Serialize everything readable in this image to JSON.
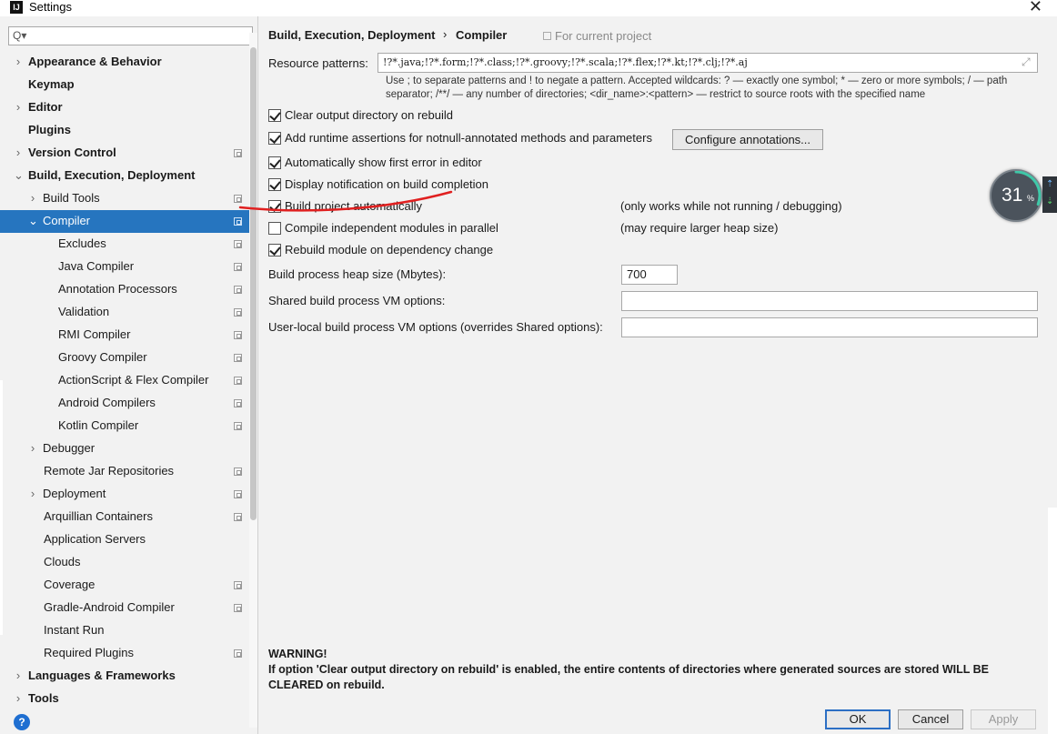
{
  "window": {
    "title": "Settings",
    "app_icon": "IJ",
    "close_glyph": "✕"
  },
  "sidebar": {
    "search_placeholder": "",
    "search_glyph": "Q▾",
    "items": [
      {
        "label": "Appearance & Behavior",
        "arrow": "›",
        "bold": true
      },
      {
        "label": "Keymap",
        "arrow": "",
        "bold": true
      },
      {
        "label": "Editor",
        "arrow": "›",
        "bold": true
      },
      {
        "label": "Plugins",
        "arrow": "",
        "bold": true
      },
      {
        "label": "Version Control",
        "arrow": "›",
        "bold": true
      },
      {
        "label": "Build, Execution, Deployment",
        "arrow": "⌄",
        "bold": true
      },
      {
        "label": "Build Tools",
        "arrow": "›",
        "bold": false
      },
      {
        "label": "Compiler",
        "arrow": "⌄",
        "bold": false,
        "selected": true
      },
      {
        "label": "Excludes",
        "arrow": "",
        "bold": false
      },
      {
        "label": "Java Compiler",
        "arrow": "",
        "bold": false
      },
      {
        "label": "Annotation Processors",
        "arrow": "",
        "bold": false
      },
      {
        "label": "Validation",
        "arrow": "",
        "bold": false
      },
      {
        "label": "RMI Compiler",
        "arrow": "",
        "bold": false
      },
      {
        "label": "Groovy Compiler",
        "arrow": "",
        "bold": false
      },
      {
        "label": "ActionScript & Flex Compiler",
        "arrow": "",
        "bold": false
      },
      {
        "label": "Android Compilers",
        "arrow": "",
        "bold": false
      },
      {
        "label": "Kotlin Compiler",
        "arrow": "",
        "bold": false
      },
      {
        "label": "Debugger",
        "arrow": "›",
        "bold": false
      },
      {
        "label": "Remote Jar Repositories",
        "arrow": "",
        "bold": false
      },
      {
        "label": "Deployment",
        "arrow": "›",
        "bold": false
      },
      {
        "label": "Arquillian Containers",
        "arrow": "",
        "bold": false
      },
      {
        "label": "Application Servers",
        "arrow": "",
        "bold": false
      },
      {
        "label": "Clouds",
        "arrow": "",
        "bold": false
      },
      {
        "label": "Coverage",
        "arrow": "",
        "bold": false
      },
      {
        "label": "Gradle-Android Compiler",
        "arrow": "",
        "bold": false
      },
      {
        "label": "Instant Run",
        "arrow": "",
        "bold": false
      },
      {
        "label": "Required Plugins",
        "arrow": "",
        "bold": false
      },
      {
        "label": "Languages & Frameworks",
        "arrow": "›",
        "bold": true
      },
      {
        "label": "Tools",
        "arrow": "›",
        "bold": true
      }
    ]
  },
  "main": {
    "breadcrumb": [
      "Build, Execution, Deployment",
      "Compiler"
    ],
    "breadcrumb_sep": "›",
    "project_scope": "For current project",
    "resource_patterns": {
      "label": "Resource patterns:",
      "value": "!?*.java;!?*.form;!?*.class;!?*.groovy;!?*.scala;!?*.flex;!?*.kt;!?*.clj;!?*.aj",
      "hint": "Use ; to separate patterns and ! to negate a pattern. Accepted wildcards: ? — exactly one symbol; * — zero or more symbols; / — path separator; /**/ — any number of directories; <dir_name>:<pattern> — restrict to source roots with the specified name"
    },
    "checkboxes": [
      {
        "label": "Clear output directory on rebuild",
        "checked": true
      },
      {
        "label": "Add runtime assertions for notnull-annotated methods and parameters",
        "checked": true
      },
      {
        "label": "Automatically show first error in editor",
        "checked": true
      },
      {
        "label": "Display notification on build completion",
        "checked": true
      },
      {
        "label": "Build project automatically",
        "checked": true,
        "note": "(only works while not running / debugging)"
      },
      {
        "label": "Compile independent modules in parallel",
        "checked": false,
        "note": "(may require larger heap size)"
      },
      {
        "label": "Rebuild module on dependency change",
        "checked": true
      }
    ],
    "configure_button": "Configure annotations...",
    "fields": [
      {
        "label": "Build process heap size (Mbytes):",
        "value": "700"
      },
      {
        "label": "Shared build process VM options:",
        "value": ""
      },
      {
        "label": "User-local build process VM options (overrides Shared options):",
        "value": ""
      }
    ],
    "warning": {
      "title": "WARNING!",
      "text": "If option 'Clear output directory on rebuild' is enabled, the entire contents of directories where generated sources are stored WILL BE CLEARED on rebuild."
    }
  },
  "footer": {
    "ok": "OK",
    "cancel": "Cancel",
    "apply": "Apply",
    "help": "?"
  },
  "overlay": {
    "value": "31",
    "unit": "%",
    "progress_fraction": 0.31,
    "accent_color": "#3fc8a8"
  },
  "colors": {
    "selection": "#2675bf",
    "annotation_red": "#e02020"
  }
}
